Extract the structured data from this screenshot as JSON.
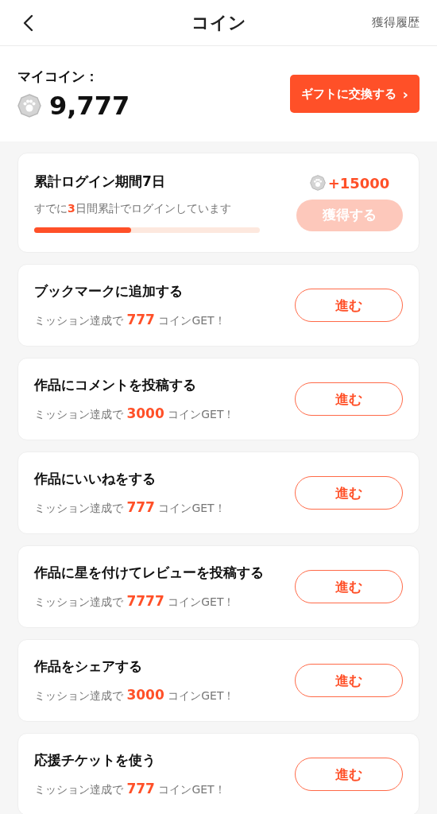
{
  "header": {
    "title": "コイン",
    "history_link": "獲得履歴"
  },
  "my_coins": {
    "label": "マイコイン：",
    "amount": "9,777",
    "exchange_button": "ギフトに交換する",
    "exchange_chevron": "›"
  },
  "login_card": {
    "title": "累計ログイン期間7日",
    "subtitle": "すでに**3**日間累計でログインしています",
    "level": 0.43,
    "reward": "+15000",
    "claim_button": "獲得する",
    "disabled": true
  },
  "missions": [
    {
      "title": "ブックマークに追加する",
      "reward": "ミッション達成で **777** コインGET！",
      "button": "進む"
    },
    {
      "title": "作品にコメントを投稿する",
      "reward": "ミッション達成で **3000** コインGET！",
      "button": "進む"
    },
    {
      "title": "作品にいいねをする",
      "reward": "ミッション達成で **777** コインGET！",
      "button": "進む"
    },
    {
      "title": "作品に星を付けてレビューを投稿する",
      "reward": "ミッション達成で **7777** コインGET！",
      "button": "進む"
    },
    {
      "title": "作品をシェアする",
      "reward": "ミッション達成で **3000** コインGET！",
      "button": "進む"
    },
    {
      "title": "応援チケットを使う",
      "reward": "ミッション達成で **777** コインGET！",
      "button": "進む"
    }
  ]
}
